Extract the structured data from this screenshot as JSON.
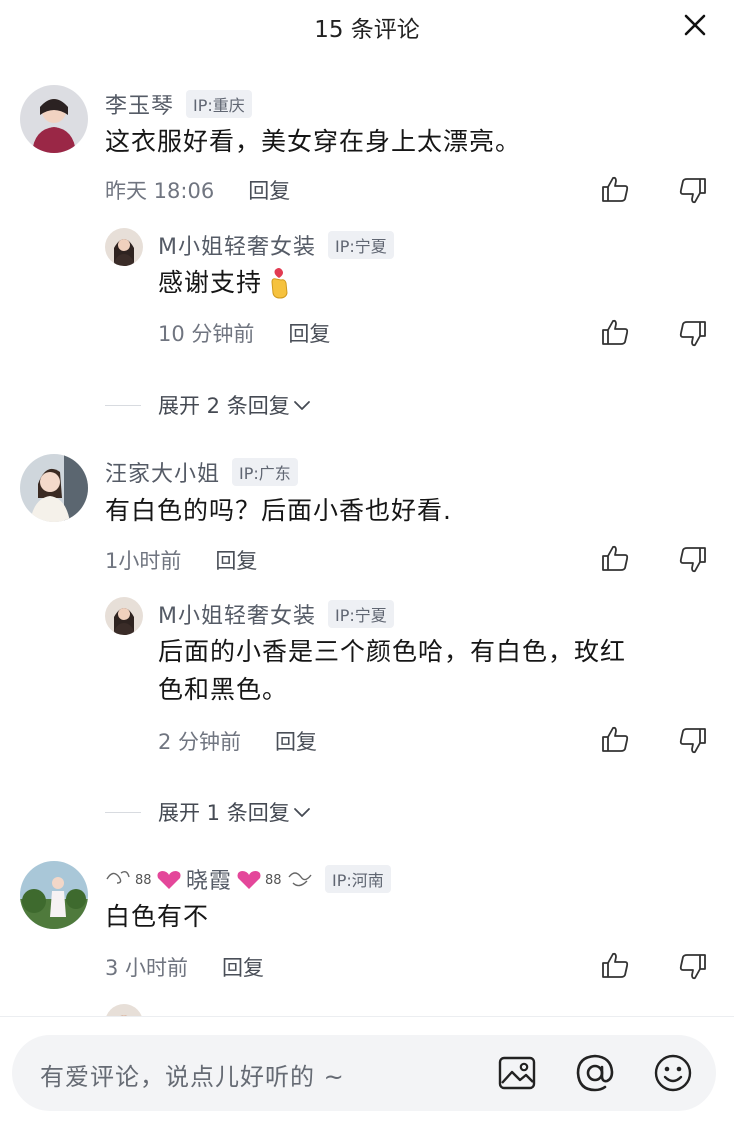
{
  "header": {
    "title": "15 条评论"
  },
  "comments": [
    {
      "username": "李玉琴",
      "ip": "IP:重庆",
      "content": "这衣服好看，美女穿在身上太漂亮。",
      "time": "昨天 18:06",
      "reply_label": "回复",
      "reply": {
        "username": "M小姐轻奢女装",
        "ip": "IP:宁夏",
        "content": "感谢支持",
        "time": "10 分钟前",
        "reply_label": "回复"
      },
      "expand_label": "展开 2 条回复"
    },
    {
      "username": "汪家大小姐",
      "ip": "IP:广东",
      "content": "有白色的吗？后面小香也好看.",
      "time": "1小时前",
      "reply_label": "回复",
      "reply": {
        "username": "M小姐轻奢女装",
        "ip": "IP:宁夏",
        "content_line1": "后面的小香是三个颜色哈，有白色，玫红",
        "content_line2": "色和黑色。",
        "time": "2 分钟前",
        "reply_label": "回复"
      },
      "expand_label": "展开 1 条回复"
    },
    {
      "username": "晓霞",
      "ip": "IP:河南",
      "content": "白色有不",
      "time": "3 小时前",
      "reply_label": "回复"
    }
  ],
  "input": {
    "placeholder": "有爱评论，说点儿好听的 ~"
  },
  "icons": [
    "close-icon",
    "thumb-up-icon",
    "thumb-down-icon",
    "chevron-down-icon",
    "image-icon",
    "at-icon",
    "emoji-icon"
  ],
  "colors": {
    "text_primary": "#161616",
    "text_secondary": "#707580",
    "badge_bg": "#eef0f4",
    "input_bg": "#f3f4f6"
  }
}
